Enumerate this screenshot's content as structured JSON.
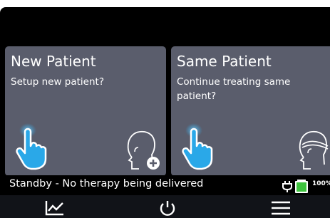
{
  "cards": {
    "new_patient": {
      "title": "New Patient",
      "subtitle": "Setup new patient?",
      "icon": "head-plus-icon"
    },
    "same_patient": {
      "title": "Same Patient",
      "subtitle": "Continue treating same patient?",
      "icon": "head-band-icon"
    }
  },
  "status": {
    "text": "Standby - No therapy being delivered",
    "battery_percent": "100%",
    "battery_level": 1.0
  },
  "nav": {
    "items": [
      "chart-icon",
      "power-icon",
      "menu-icon"
    ]
  },
  "colors": {
    "card": "#5a5d6c",
    "accent_blue": "#2aa8e8",
    "battery_green": "#3ec43e"
  }
}
